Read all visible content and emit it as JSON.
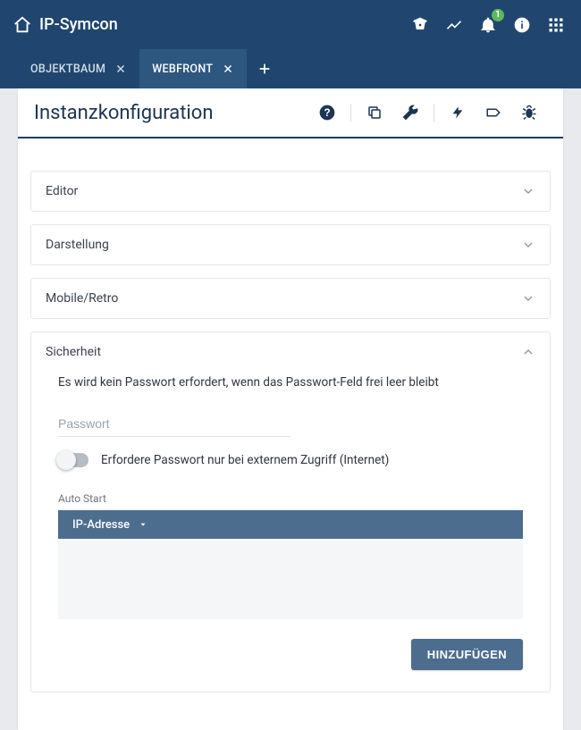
{
  "brand": {
    "name": "IP-Symcon"
  },
  "notifications": {
    "count": "1"
  },
  "tabs": [
    {
      "label": "OBJEKTBAUM",
      "active": false,
      "closable": true
    },
    {
      "label": "WEBFRONT",
      "active": true,
      "closable": true
    }
  ],
  "panel": {
    "title": "Instanzkonfiguration"
  },
  "sections": {
    "editor": {
      "label": "Editor",
      "open": false
    },
    "darstellung": {
      "label": "Darstellung",
      "open": false
    },
    "mobile": {
      "label": "Mobile/Retro",
      "open": false
    },
    "security": {
      "label": "Sicherheit",
      "open": true,
      "hint": "Es wird kein Passwort erfordert, wenn das Passwort-Feld frei leer bleibt",
      "password": {
        "placeholder": "Passwort",
        "value": ""
      },
      "external_only": {
        "label": "Erfordere Passwort nur bei externem Zugriff (Internet)",
        "enabled": false
      },
      "autostart": {
        "label": "Auto Start",
        "column": "IP-Adresse",
        "rows": []
      },
      "add_button": "HINZUFÜGEN"
    }
  }
}
